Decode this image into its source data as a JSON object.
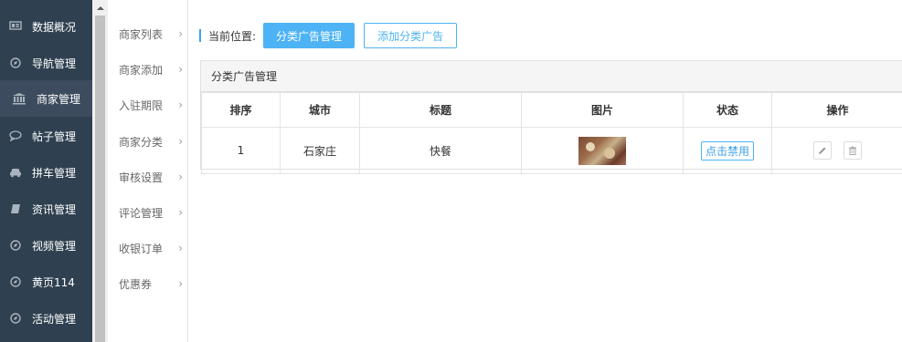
{
  "sidebar": {
    "items": [
      {
        "label": "数据概况",
        "icon": "monitor-icon"
      },
      {
        "label": "导航管理",
        "icon": "compass-icon"
      },
      {
        "label": "商家管理",
        "icon": "bank-icon",
        "active": true
      },
      {
        "label": "帖子管理",
        "icon": "chat-bubble-icon"
      },
      {
        "label": "拼车管理",
        "icon": "car-icon"
      },
      {
        "label": "资讯管理",
        "icon": "book-icon"
      },
      {
        "label": "视频管理",
        "icon": "compass-icon"
      },
      {
        "label": "黄页114",
        "icon": "compass-icon"
      },
      {
        "label": "活动管理",
        "icon": "compass-icon"
      }
    ]
  },
  "submenu": {
    "items": [
      {
        "label": "商家列表"
      },
      {
        "label": "商家添加"
      },
      {
        "label": "入驻期限"
      },
      {
        "label": "商家分类"
      },
      {
        "label": "审核设置"
      },
      {
        "label": "评论管理"
      },
      {
        "label": "收银订单"
      },
      {
        "label": "优惠券"
      }
    ],
    "arrow": "›"
  },
  "breadcrumb": {
    "label": "当前位置:",
    "primary_button": "分类广告管理",
    "secondary_button": "添加分类广告"
  },
  "panel": {
    "title": "分类广告管理",
    "columns": [
      "排序",
      "城市",
      "标题",
      "图片",
      "状态",
      "操作"
    ],
    "rows": [
      {
        "order": "1",
        "city": "石家庄",
        "title": "快餐",
        "status": "点击禁用"
      }
    ]
  },
  "colors": {
    "sidebar_bg": "#2f4050",
    "accent": "#4db3f5"
  }
}
